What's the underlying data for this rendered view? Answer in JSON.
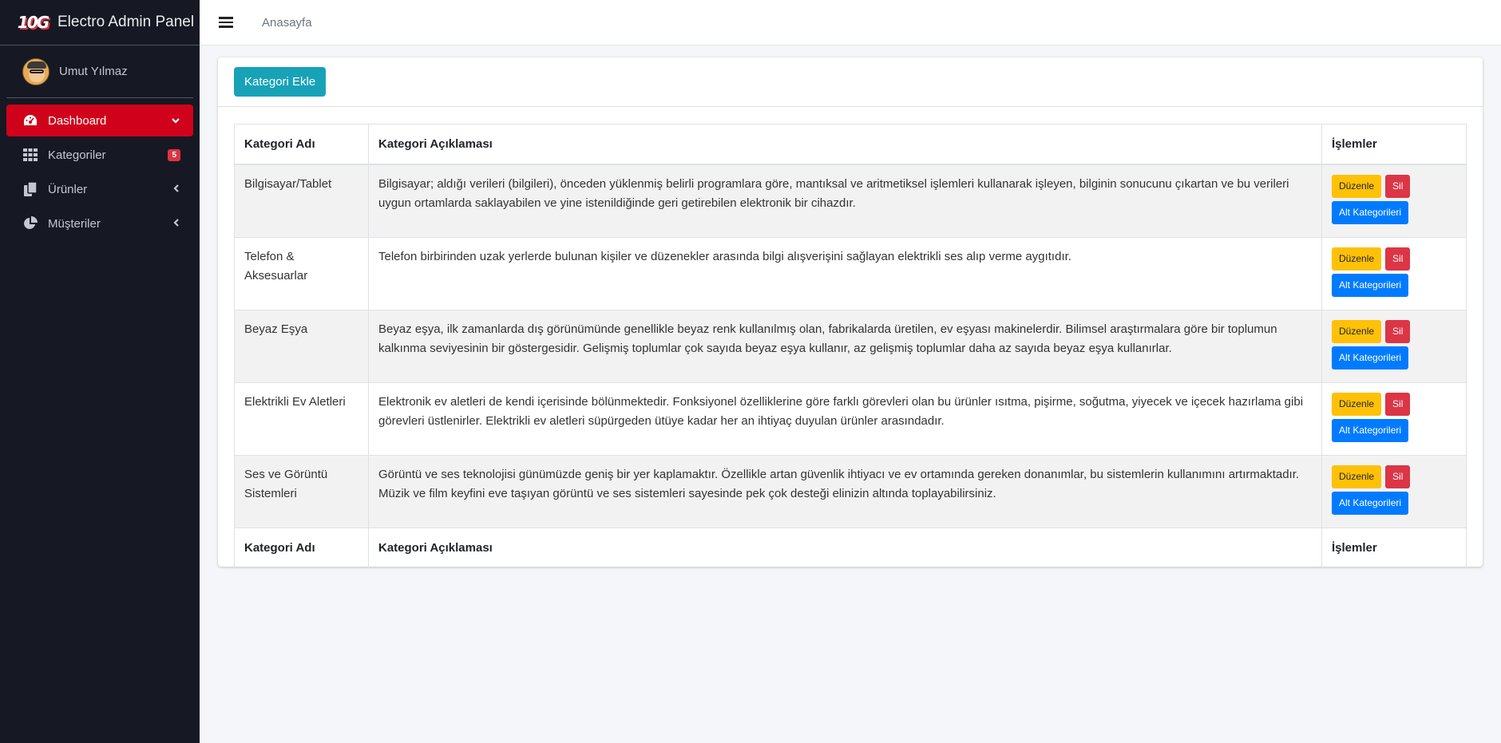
{
  "brand": {
    "logo_text": "10G",
    "title": "Electro Admin Panel"
  },
  "user": {
    "name": "Umut Yılmaz"
  },
  "nav": [
    {
      "label": "Dashboard",
      "icon": "tachometer-icon",
      "active": true
    },
    {
      "label": "Kategoriler",
      "icon": "grid-icon",
      "badge": "5"
    },
    {
      "label": "Ürünler",
      "icon": "copy-icon"
    },
    {
      "label": "Müşteriler",
      "icon": "pie-chart-icon"
    }
  ],
  "topbar": {
    "breadcrumb": "Anasayfa"
  },
  "card": {
    "add_button": "Kategori Ekle"
  },
  "table": {
    "headers": [
      "Kategori Adı",
      "Kategori Açıklaması",
      "İşlemler"
    ],
    "rows": [
      {
        "name": "Bilgisayar/Tablet",
        "description": "Bilgisayar; aldığı verileri (bilgileri), önceden yüklenmiş belirli programlara göre, mantıksal ve aritmetiksel işlemleri kullanarak işleyen, bilginin sonucunu çıkartan ve bu verileri uygun ortamlarda saklayabilen ve yine istenildiğinde geri getirebilen elektronik bir cihazdır."
      },
      {
        "name": "Telefon & Aksesuarlar",
        "description": "Telefon birbirinden uzak yerlerde bulunan kişiler ve düzenekler arasında bilgi alışverişini sağlayan elektrikli ses alıp verme aygıtıdır."
      },
      {
        "name": "Beyaz Eşya",
        "description": "Beyaz eşya, ilk zamanlarda dış görünümünde genellikle beyaz renk kullanılmış olan, fabrikalarda üretilen, ev eşyası makinelerdir. Bilimsel araştırmalara göre bir toplumun kalkınma seviyesinin bir göstergesidir. Gelişmiş toplumlar çok sayıda beyaz eşya kullanır, az gelişmiş toplumlar daha az sayıda beyaz eşya kullanırlar."
      },
      {
        "name": "Elektrikli Ev Aletleri",
        "description": "Elektronik ev aletleri de kendi içerisinde bölünmektedir. Fonksiyonel özelliklerine göre farklı görevleri olan bu ürünler ısıtma, pişirme, soğutma, yiyecek ve içecek hazırlama gibi görevleri üstlenirler. Elektrikli ev aletleri süpürgeden ütüye kadar her an ihtiyaç duyulan ürünler arasındadır."
      },
      {
        "name": "Ses ve Görüntü Sistemleri",
        "description": "Görüntü ve ses teknolojisi günümüzde geniş bir yer kaplamaktır. Özellikle artan güvenlik ihtiyacı ve ev ortamında gereken donanımlar, bu sistemlerin kullanımını artırmaktadır. Müzik ve film keyfini eve taşıyan görüntü ve ses sistemleri sayesinde pek çok desteği elinizin altında toplayabilirsiniz."
      }
    ],
    "actions": {
      "edit": "Düzenle",
      "delete": "Sil",
      "subcategories": "Alt Kategorileri"
    }
  },
  "colors": {
    "sidebar_bg": "#161923",
    "active_nav": "#d0021b",
    "add_button": "#17a2b8",
    "edit": "#ffc107",
    "delete": "#dc3545",
    "sub": "#007bff"
  }
}
